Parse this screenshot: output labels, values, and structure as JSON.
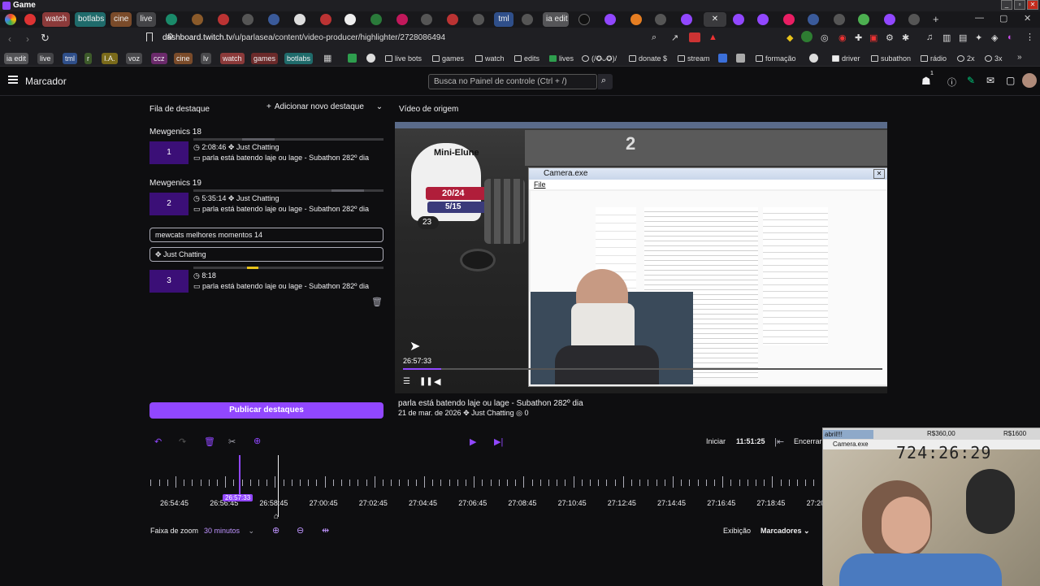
{
  "window": {
    "title": "Game"
  },
  "tabs": [
    {
      "label": "watch",
      "color": "#8b3a3a"
    },
    {
      "label": "botlabs",
      "color": "#1f6b6b"
    },
    {
      "label": "cine",
      "color": "#7a4b2a"
    },
    {
      "label": "live",
      "color": "#444447"
    },
    {
      "label": "tml",
      "color": "#2f4f8a"
    },
    {
      "label": "ia edit",
      "color": "#555558"
    }
  ],
  "address": {
    "domain": "dashboard.twitch.tv",
    "path": "/u/parlasea/content/video-producer/highlighter/2728086494"
  },
  "bookmarks": [
    {
      "label": "ia edit",
      "color": "#555558"
    },
    {
      "label": "live",
      "color": "#444447"
    },
    {
      "label": "tml",
      "color": "#2f4f8a"
    },
    {
      "label": "r",
      "color": "#3d5a2a"
    },
    {
      "label": "I.A.",
      "color": "#7a6a1a"
    },
    {
      "label": "voz",
      "color": "#4a4a4d"
    },
    {
      "label": "ccz",
      "color": "#6b2a6b"
    },
    {
      "label": "cine",
      "color": "#7a4b2a"
    },
    {
      "label": "lv",
      "color": "#4a4a4d"
    },
    {
      "label": "watch",
      "color": "#8b3a3a"
    },
    {
      "label": "games",
      "color": "#6b2a2a"
    },
    {
      "label": "botlabs",
      "color": "#1f6b6b"
    }
  ],
  "bookmark_folders": [
    "live bots",
    "games",
    "watch",
    "edits",
    "lives",
    "(/✪ᴗ✪)/",
    "donate $",
    "stream",
    "formação",
    "driver",
    "subathon",
    "rádio",
    "2x",
    "3x"
  ],
  "nav": {
    "title": "Marcador",
    "search_placeholder": "Busca no Painel de controle (Ctrl + /)",
    "notif_count": "1"
  },
  "queue": {
    "title": "Fila de destaque",
    "add_label": "Adicionar novo destaque",
    "groups": [
      {
        "name": "Mewgenics 18",
        "num": "1",
        "time": "2:08:46",
        "category": "Just Chatting",
        "title": "parla está batendo laje ou lage - Subathon 282º dia"
      },
      {
        "name": "Mewgenics 19",
        "num": "2",
        "time": "5:35:14",
        "category": "Just Chatting",
        "title": "parla está batendo laje ou lage - Subathon 282º dia"
      }
    ],
    "edit_title": "mewcats melhores momentos 14",
    "edit_category": "Just Chatting",
    "third": {
      "num": "3",
      "time": "8:18",
      "title": "parla está batendo laje ou lage - Subathon 282º dia"
    },
    "publish_label": "Publicar destaques"
  },
  "source": {
    "title": "Vídeo de origem",
    "video_time": "26:57:33",
    "stream_title": "parla está batendo laje ou lage - Subathon 282º dia",
    "date": "21 de mar. de 2026",
    "category": "Just Chatting",
    "views": "0",
    "game_name": "Mini-Elune",
    "hp": "20/24",
    "mana": "5/15",
    "level": "23",
    "big_number": "2"
  },
  "camera_window": {
    "title": "Camera.exe",
    "menu": "File"
  },
  "timeline": {
    "start_label": "Iniciar",
    "start_time": "11:51:25",
    "end_label": "Encerrar",
    "playhead": "26:57:33",
    "labels": [
      "26:54:45",
      "26:56:45",
      "26:58:45",
      "27:00:45",
      "27:02:45",
      "27:04:45",
      "27:06:45",
      "27:08:45",
      "27:10:45",
      "27:12:45",
      "27:14:45",
      "27:16:45",
      "27:18:45",
      "27:20:45"
    ],
    "zoom_label": "Faixa de zoom",
    "zoom_value": "30 minutos",
    "view_label": "Exibição",
    "view_value": "Marcadores"
  },
  "overlay": {
    "tag": "abril!!!",
    "money1": "R$360,00",
    "money2": "R$1600",
    "cam_title": "Camera.exe",
    "timer": "724:26:29"
  }
}
